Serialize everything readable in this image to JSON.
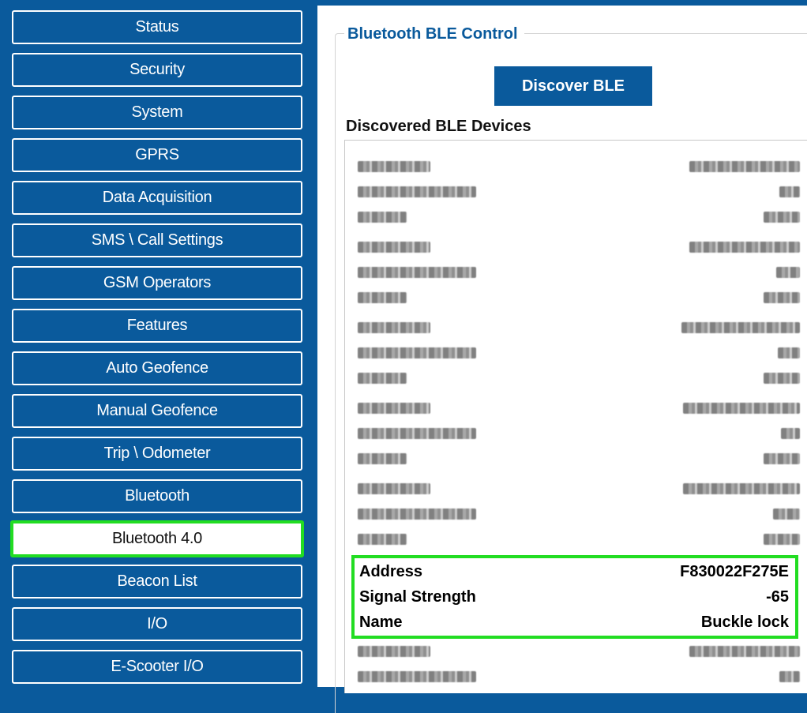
{
  "sidebar": {
    "items": [
      {
        "label": "Status"
      },
      {
        "label": "Security"
      },
      {
        "label": "System"
      },
      {
        "label": "GPRS"
      },
      {
        "label": "Data Acquisition"
      },
      {
        "label": "SMS \\ Call Settings"
      },
      {
        "label": "GSM Operators"
      },
      {
        "label": "Features"
      },
      {
        "label": "Auto Geofence"
      },
      {
        "label": "Manual Geofence"
      },
      {
        "label": "Trip \\ Odometer"
      },
      {
        "label": "Bluetooth"
      },
      {
        "label": "Bluetooth 4.0",
        "active": true
      },
      {
        "label": "Beacon List"
      },
      {
        "label": "I/O"
      },
      {
        "label": "E-Scooter I/O"
      }
    ]
  },
  "main": {
    "group_title": "Bluetooth BLE Control",
    "discover_button": "Discover BLE",
    "list_label": "Discovered BLE Devices",
    "selected_device": {
      "address_label": "Address",
      "address_value": "F830022F275E",
      "signal_label": "Signal Strength",
      "signal_value": "-65",
      "name_label": "Name",
      "name_value": "Buckle lock"
    }
  },
  "colors": {
    "brand_blue": "#0a5a9c",
    "highlight_green": "#22dd22"
  }
}
